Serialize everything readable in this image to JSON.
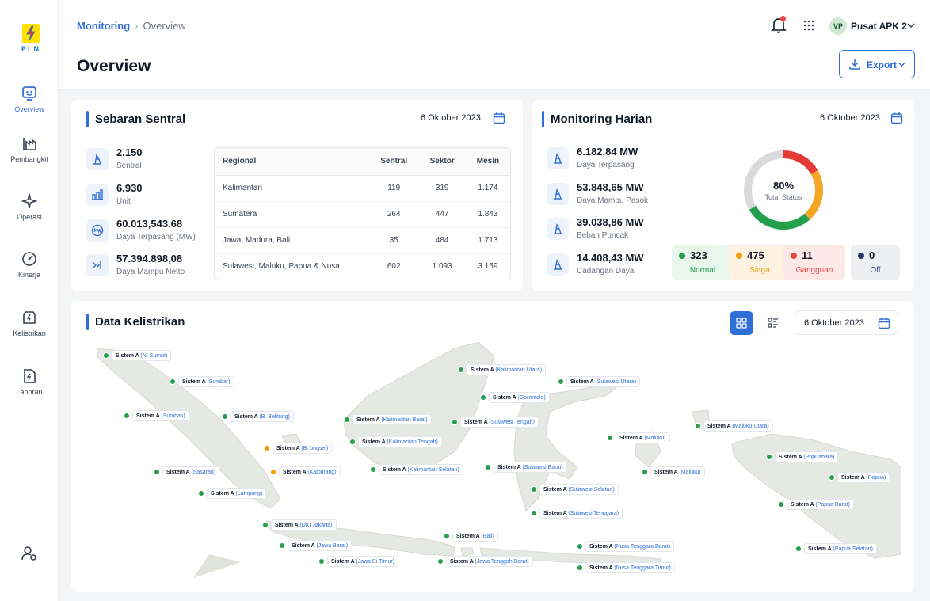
{
  "brand": {
    "logo_text": "PLN",
    "accent": "#2f6fd6"
  },
  "sidebar": {
    "items": [
      {
        "label": "Overview",
        "icon": "overview-icon"
      },
      {
        "label": "Pembangkit",
        "icon": "pembangkit-icon"
      },
      {
        "label": "Operasi",
        "icon": "operasi-icon"
      },
      {
        "label": "Kinerja",
        "icon": "kinerja-icon"
      },
      {
        "label": "Kelistrikan",
        "icon": "kelistrikan-icon"
      },
      {
        "label": "Laporan",
        "icon": "laporan-icon"
      }
    ]
  },
  "header": {
    "breadcrumb": {
      "root": "Monitoring",
      "current": "Overview"
    },
    "user": {
      "initials": "VP",
      "name": "Pusat APK 2"
    }
  },
  "page": {
    "title": "Overview",
    "export_label": "Export"
  },
  "sebaran": {
    "title": "Sebaran Sentral",
    "date": "6 Oktober 2023",
    "stats": [
      {
        "value": "2.150",
        "label": "Sentral"
      },
      {
        "value": "6.930",
        "label": "Unit"
      },
      {
        "value": "60.013,543.68",
        "label": "Daya Terpasang (MW)"
      },
      {
        "value": "57.394.898,08",
        "label": "Daya Mampu Netto"
      }
    ],
    "table": {
      "headers": [
        "Regional",
        "Sentral",
        "Sektor",
        "Mesin"
      ],
      "rows": [
        [
          "Kalimantan",
          "119",
          "319",
          "1.174"
        ],
        [
          "Sumatera",
          "264",
          "447",
          "1.843"
        ],
        [
          "Jawa, Madura, Bali",
          "35",
          "484",
          "1.713"
        ],
        [
          "Sulawesi, Maluku, Papua & Nusa",
          "602",
          "1.093",
          "3.159"
        ]
      ]
    }
  },
  "monitoring": {
    "title": "Monitoring Harian",
    "date": "6 Oktober 2023",
    "stats": [
      {
        "value": "6.182,84 MW",
        "label": "Daya Terpasang"
      },
      {
        "value": "53.848,65 MW",
        "label": "Daya Mampu Pasok"
      },
      {
        "value": "39.038,86 MW",
        "label": "Beban Puncak"
      },
      {
        "value": "14.408,43 MW",
        "label": "Cadangan Daya"
      }
    ],
    "donut": {
      "percent": "80%",
      "label": "Total Status",
      "fraction": 0.8
    },
    "status": [
      {
        "value": "323",
        "label": "Normal",
        "color": "#22a04b",
        "bg": "#e8f6ec"
      },
      {
        "value": "475",
        "label": "Siaga",
        "color": "#f59e0b",
        "bg": "#fdf1e1"
      },
      {
        "value": "11",
        "label": "Gangguan",
        "color": "#ef4444",
        "bg": "#fde8e8"
      },
      {
        "value": "0",
        "label": "Off",
        "color": "#1e3a6e",
        "bg": "#eeeff1"
      }
    ]
  },
  "kelistrikan": {
    "title": "Data Kelistrikan",
    "date": "6 Oktober 2023",
    "markers": [
      {
        "name": "Sistem A",
        "region": "(N. Sumut)",
        "status": "green"
      },
      {
        "name": "Sistem A",
        "region": "(Sumbar)",
        "status": "green"
      },
      {
        "name": "Sistem A",
        "region": "(Sumbas)",
        "status": "green"
      },
      {
        "name": "Sistem A",
        "region": "(B. Belitung)",
        "status": "green"
      },
      {
        "name": "Sistem A",
        "region": "(B. bngsel)",
        "status": "orange"
      },
      {
        "name": "Sistem A",
        "region": "(Sasarad)",
        "status": "green"
      },
      {
        "name": "Sistem A",
        "region": "(Kalomang)",
        "status": "orange"
      },
      {
        "name": "Sistem A",
        "region": "(Lampung)",
        "status": "green"
      },
      {
        "name": "Sistem A",
        "region": "(DKI Jakarta)",
        "status": "green"
      },
      {
        "name": "Sistem A",
        "region": "(Jawa Barat)",
        "status": "green"
      },
      {
        "name": "Sistem A",
        "region": "(Jawa Bi Timur)",
        "status": "green"
      },
      {
        "name": "Sistem A",
        "region": "(Kalimantan Barat)",
        "status": "green"
      },
      {
        "name": "Sistem A",
        "region": "(Kalimantan Tengah)",
        "status": "green"
      },
      {
        "name": "Sistem A",
        "region": "(Kalimantan Selatan)",
        "status": "green"
      },
      {
        "name": "Sistem A",
        "region": "(Kalimantan Utara)",
        "status": "green"
      },
      {
        "name": "Sistem A",
        "region": "(Gorontalo)",
        "status": "green"
      },
      {
        "name": "Sistem A",
        "region": "(Sulawesi Utara)",
        "status": "green"
      },
      {
        "name": "Sistem A",
        "region": "(Sulawesi Tengah)",
        "status": "green"
      },
      {
        "name": "Sistem A",
        "region": "(Sulawesi Barat)",
        "status": "green"
      },
      {
        "name": "Sistem A",
        "region": "(Sulawesi Selatan)",
        "status": "green"
      },
      {
        "name": "Sistem A",
        "region": "(Sulawesi Tenggara)",
        "status": "green"
      },
      {
        "name": "Sistem A",
        "region": "(Bali)",
        "status": "green"
      },
      {
        "name": "Sistem A",
        "region": "(Jawa Tenggah Barat)",
        "status": "green"
      },
      {
        "name": "Sistem A",
        "region": "(Nusa Tenggara Barat)",
        "status": "green"
      },
      {
        "name": "Sistem A",
        "region": "(Nusa Tenggara Timur)",
        "status": "green"
      },
      {
        "name": "Sistem A",
        "region": "(Maluku)",
        "status": "green"
      },
      {
        "name": "Sistem A",
        "region": "(Maluku)",
        "status": "green"
      },
      {
        "name": "Sistem A",
        "region": "(Maluku Utara)",
        "status": "green"
      },
      {
        "name": "Sistem A",
        "region": "(Popuabara)",
        "status": "green"
      },
      {
        "name": "Sistem A",
        "region": "(Papua)",
        "status": "green"
      },
      {
        "name": "Sistem A",
        "region": "(Papua Barat)",
        "status": "green"
      },
      {
        "name": "Sistem A",
        "region": "(Papua Selatan)",
        "status": "green"
      }
    ]
  },
  "colors": {
    "green": "#22a04b",
    "orange": "#f59e0b"
  }
}
